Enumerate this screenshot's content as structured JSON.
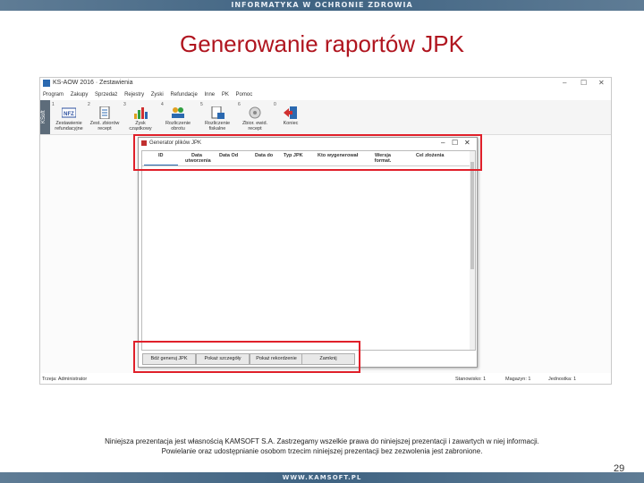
{
  "slide": {
    "top_banner": "INFORMATYKA W OCHRONIE ZDROWIA",
    "title": "Generowanie raportów JPK",
    "footer_line1": "Niniejsza prezentacja jest własnością KAMSOFT S.A. Zastrzegamy wszelkie prawa do niniejszej prezentacji i zawartych w niej informacji.",
    "footer_line2": "Powielanie oraz udostępnianie osobom trzecim niniejszej prezentacji bez zezwolenia jest zabronione.",
    "page_number": "29",
    "bottom_banner": "WWW.KAMSOFT.PL"
  },
  "app": {
    "window_title": "KS-AOW 2016 · Zestawienia",
    "window_controls": [
      "–",
      "☐",
      "✕"
    ],
    "menu": [
      "Program",
      "Zakupy",
      "Sprzedaż",
      "Rejestry",
      "Zyski",
      "Refundacje",
      "Inne",
      "PK",
      "Pomoc"
    ],
    "side_tab": "KSoft",
    "ribbon": [
      {
        "num": "1",
        "icon": "nfz-icon",
        "line1": "Zestawienie",
        "line2": "refundacyjne"
      },
      {
        "num": "2",
        "icon": "document-icon",
        "line1": "Zest. zbiorów",
        "line2": "recept"
      },
      {
        "num": "3",
        "icon": "chart-icon",
        "line1": "Zysk",
        "line2": "cząstkowy"
      },
      {
        "num": "4",
        "icon": "people-icon",
        "line1": "Rozliczenie",
        "line2": "obrotu"
      },
      {
        "num": "5",
        "icon": "tax-document-icon",
        "line1": "Rozliczenie",
        "line2": "fiskalne"
      },
      {
        "num": "6",
        "icon": "archive-icon",
        "line1": "Zbior. ewid.",
        "line2": "recept"
      },
      {
        "num": "0",
        "icon": "exit-icon",
        "line1": "Koniec",
        "line2": ""
      }
    ],
    "status": {
      "user": "Trzeja: Administrator",
      "station": "Stanowisko: 1",
      "warehouse": "Magazyn: 1",
      "unit": "Jednostka: 1"
    }
  },
  "dialog": {
    "title": "Generator plików JPK",
    "columns": [
      "ID",
      "Data utworzenia",
      "Data Od",
      "Data do",
      "Typ JPK",
      "Kto wygenerował",
      "Wersja format.",
      "Cel złożenia"
    ],
    "rows": [],
    "buttons": [
      "Bdź generuj JPK",
      "Pokaż szczegóły",
      "Pokaż rekordzenie",
      "Zamknij"
    ]
  }
}
